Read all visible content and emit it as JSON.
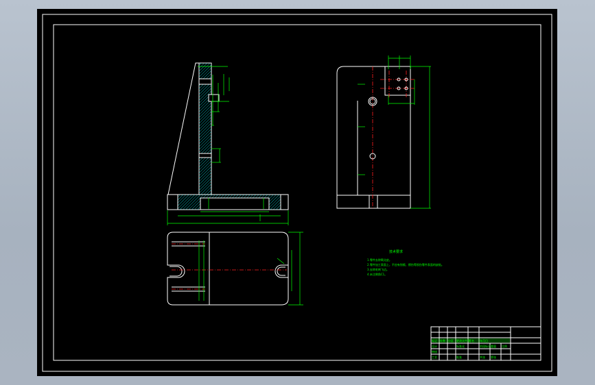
{
  "drawing": {
    "notes_title": "技术要求",
    "notes": [
      "1.零件去除氧化皮。",
      "2.零件加工表面上，不应有划痕、擦伤等损伤零件表面的缺陷。",
      "3.去除毛刺飞边。",
      "4.未注倒角C1。"
    ]
  },
  "title_block": {
    "cells": [
      "标记",
      "处数",
      "分区",
      "更改文件号",
      "签名",
      "年月日",
      "设计",
      "标准化",
      "审核",
      "工艺",
      "批准",
      "阶段标记",
      "重量",
      "比例",
      "共张",
      "第张"
    ]
  }
}
